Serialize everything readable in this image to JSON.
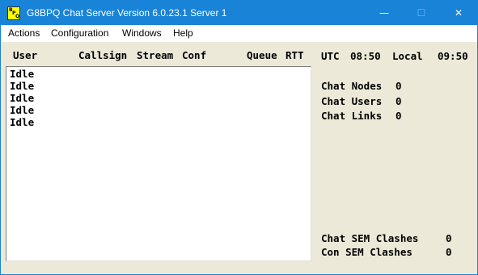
{
  "window": {
    "title": "G8BPQ Chat Server Version 6.0.23.1  Server 1",
    "icon_letters": [
      "B",
      "P",
      "Q"
    ],
    "minimize_glyph": "—",
    "maximize_glyph": "☐",
    "close_glyph": "✕"
  },
  "menu": {
    "items": [
      "Actions",
      "Configuration",
      "Windows",
      "Help"
    ]
  },
  "header": {
    "user": "User",
    "callsign": "Callsign",
    "stream": "Stream",
    "conf": "Conf",
    "queue": "Queue",
    "rtt": "RTT"
  },
  "clock": {
    "utc_label": "UTC",
    "utc_time": "08:50",
    "local_label": "Local",
    "local_time": "09:50"
  },
  "sessions": [
    "Idle",
    "Idle",
    "Idle",
    "Idle",
    "Idle"
  ],
  "stats": {
    "chat_nodes_label": "Chat Nodes",
    "chat_nodes_value": "0",
    "chat_users_label": "Chat Users",
    "chat_users_value": "0",
    "chat_links_label": "Chat Links",
    "chat_links_value": "0",
    "chat_sem_label": "Chat SEM Clashes",
    "chat_sem_value": "0",
    "con_sem_label": "Con SEM Clashes",
    "con_sem_value": "0"
  }
}
